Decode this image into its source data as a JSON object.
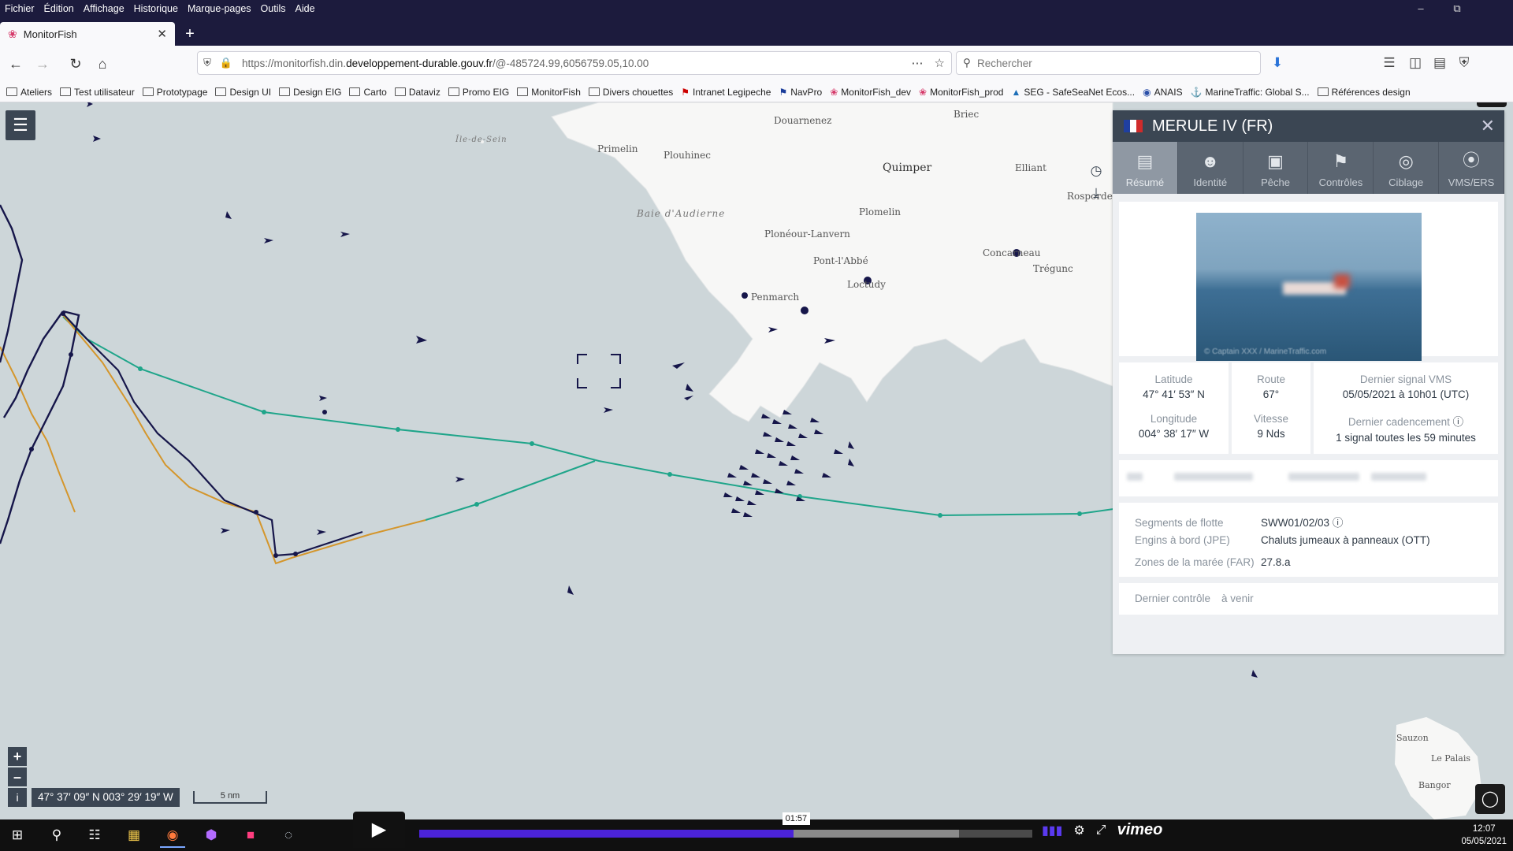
{
  "menubar": {
    "items": [
      "Fichier",
      "Édition",
      "Affichage",
      "Historique",
      "Marque-pages",
      "Outils",
      "Aide"
    ]
  },
  "tab": {
    "title": "MonitorFish"
  },
  "navbar": {
    "url_prefix": "https://monitorfish.din.",
    "url_domain": "developpement-durable.gouv.fr",
    "url_suffix": "/@-485724.99,6056759.05,10.00",
    "search_placeholder": "Rechercher"
  },
  "bookmarks": [
    "Ateliers",
    "Test utilisateur",
    "Prototypage",
    "Design UI",
    "Design EIG",
    "Carto",
    "Dataviz",
    "Promo EIG",
    "MonitorFish",
    "Divers chouettes",
    "Intranet Legipeche",
    "NavPro",
    "MonitorFish_dev",
    "MonitorFish_prod",
    "SEG - SafeSeaNet Ecos...",
    "ANAIS",
    "MarineTraffic: Global S...",
    "Références design"
  ],
  "map": {
    "places": {
      "douarnenez": "Douarnenez",
      "briec": "Briec",
      "ile_de_sein": "Île-de-Sein",
      "primelin": "Primelin",
      "plouhinec": "Plouhinec",
      "quimper": "Quimper",
      "elliant": "Elliant",
      "rosporden": "Rosporden",
      "baie": "Baie d'Audierne",
      "plomelin": "Plomelin",
      "ploneour": "Plonéour-Lanvern",
      "pont_labbe": "Pont-l'Abbé",
      "concarneau": "Concarneau",
      "tregunc": "Trégunc",
      "loctudy": "Loctudy",
      "penmarch": "Penmarch",
      "sauzon": "Sauzon",
      "le_palais": "Le Palais",
      "bangor": "Bangor"
    },
    "cursor_coords": "47° 37′ 09″ N 003° 29′ 19″ W",
    "scale_label": "5 nm",
    "colors": {
      "sea": "#cdd6d9",
      "land": "#f7f7f6",
      "vessel": "#16164a",
      "track_green": "#1fa58a",
      "track_orange": "#d4962c"
    }
  },
  "panel": {
    "vessel_name": "MERULE IV (FR)",
    "tabs": [
      {
        "label": "Résumé",
        "icon": "summary-icon"
      },
      {
        "label": "Identité",
        "icon": "identity-icon"
      },
      {
        "label": "Pêche",
        "icon": "fishing-icon"
      },
      {
        "label": "Contrôles",
        "icon": "controls-icon"
      },
      {
        "label": "Ciblage",
        "icon": "target-icon"
      },
      {
        "label": "VMS/ERS",
        "icon": "vms-icon"
      }
    ],
    "photo_watermark": "© Captain XXX / MarineTraffic.com",
    "position": {
      "latitude_label": "Latitude",
      "latitude": "47° 41′ 53″ N",
      "longitude_label": "Longitude",
      "longitude": "004° 38′ 17″ W",
      "route_label": "Route",
      "route": "67°",
      "speed_label": "Vitesse",
      "speed": "9 Nds",
      "last_vms_label": "Dernier signal VMS",
      "last_vms": "05/05/2021 à 10h01 (UTC)",
      "cadence_label": "Dernier cadencement",
      "cadence": "1 signal toutes les 59 minutes"
    },
    "fleet": {
      "segments_label": "Segments de flotte",
      "segments": "SWW01/02/03",
      "gear_label": "Engins à bord (JPE)",
      "gear": "Chaluts jumeaux à panneaux (OTT)",
      "zones_label": "Zones de la marée (FAR)",
      "zones": "27.8.a"
    },
    "control": {
      "label": "Dernier contrôle",
      "value": "à venir"
    }
  },
  "video": {
    "timecode": "01:57",
    "progress": 0.61,
    "buffered": 0.88,
    "logo": "vimeo"
  },
  "clock": {
    "time": "12:07",
    "date": "05/05/2021"
  }
}
